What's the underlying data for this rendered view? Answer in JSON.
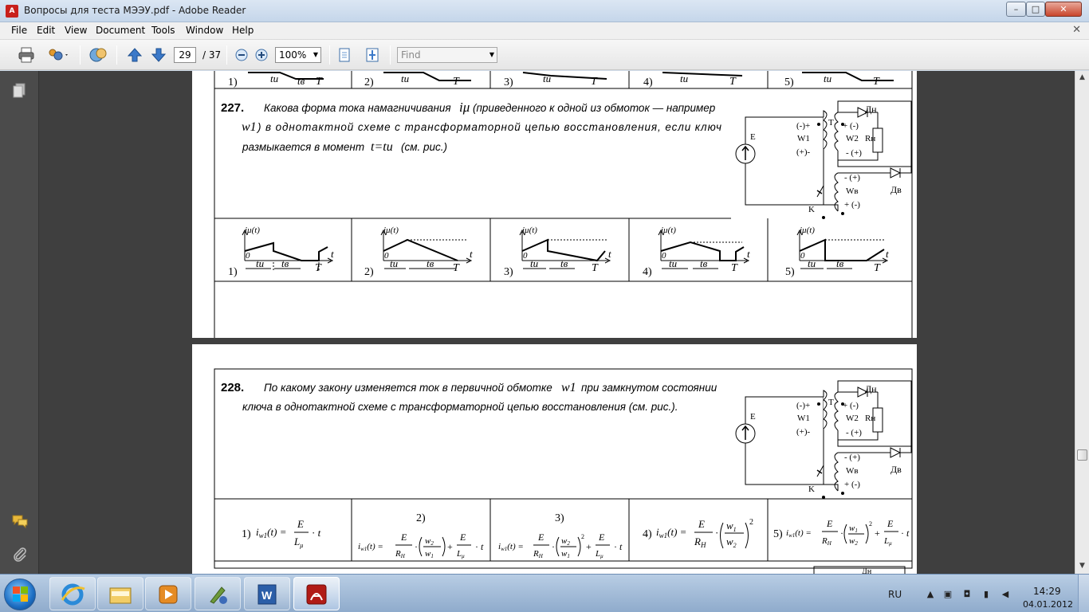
{
  "window": {
    "title": "Вопросы для теста МЭЭУ.pdf - Adobe Reader",
    "app_icon_label": "A",
    "minimize": "–",
    "maximize": "□",
    "close": "✕"
  },
  "menubar": {
    "items": [
      "File",
      "Edit",
      "View",
      "Document",
      "Tools",
      "Window",
      "Help"
    ],
    "close_doc": "✕"
  },
  "toolbar": {
    "page_current": "29",
    "page_total": "/ 37",
    "zoom_value": "100%",
    "find_placeholder": "Find",
    "dropdown_glyph": "▼"
  },
  "page1": {
    "prev_row_options": [
      "1)",
      "2)",
      "3)",
      "4)",
      "5)"
    ],
    "prev_row_ti": "tu",
    "prev_row_tv": "tв",
    "prev_row_T": "T",
    "q227": {
      "number": "227.",
      "line1_a": "Какова форма тока намагничивания",
      "line1_sym": "iμ",
      "line1_b": "(приведенного к одной из обмоток — например",
      "line2_sym": "w1",
      "line2_b": ") в однотактной схеме с трансформаторной цепью восстановления, если ключ",
      "line3_a": "размыкается в момент",
      "line3_sym": "t=tu",
      "line3_b": "(см. рис.)"
    },
    "circuit": {
      "E": "E",
      "T": "T",
      "K": "K",
      "W1": "W1",
      "W2": "W2",
      "Wv": "Wв",
      "Rn": "Rн",
      "Dn": "Дн",
      "Dv": "Дв",
      "w1_top": "(-)+",
      "w1_bot": "(+)-",
      "w2_top": "+ (-)",
      "w2_bot": "- (+)",
      "wv_top": "- (+)",
      "wv_bot": "+ (-)"
    },
    "options": [
      "1)",
      "2)",
      "3)",
      "4)",
      "5)"
    ],
    "graph_ylabel": "iμ(t)",
    "graph_zero": "0",
    "graph_t": "t",
    "graph_tu": "tu",
    "graph_tv": "tв",
    "graph_T": "T"
  },
  "page2": {
    "q228": {
      "number": "228.",
      "line1_a": "По какому закону изменяется ток в первичной обмотке",
      "line1_sym": "w1",
      "line1_b": "при замкнутом состоянии",
      "line2": "ключа в однотактной схеме с трансформаторной цепью восстановления (см. рис.)."
    },
    "answers": [
      {
        "label": "1)"
      },
      {
        "label": "2)"
      },
      {
        "label": "3)"
      },
      {
        "label": "4)"
      },
      {
        "label": "5)"
      }
    ],
    "next_label": "Дн"
  },
  "taskbar": {
    "language": "RU",
    "time": "14:29",
    "date": "04.01.2012"
  },
  "colors": {
    "doc_background": "#3f3f3f",
    "nav_pane": "#4b4b4b",
    "acrobat_red": "#c8201c"
  }
}
